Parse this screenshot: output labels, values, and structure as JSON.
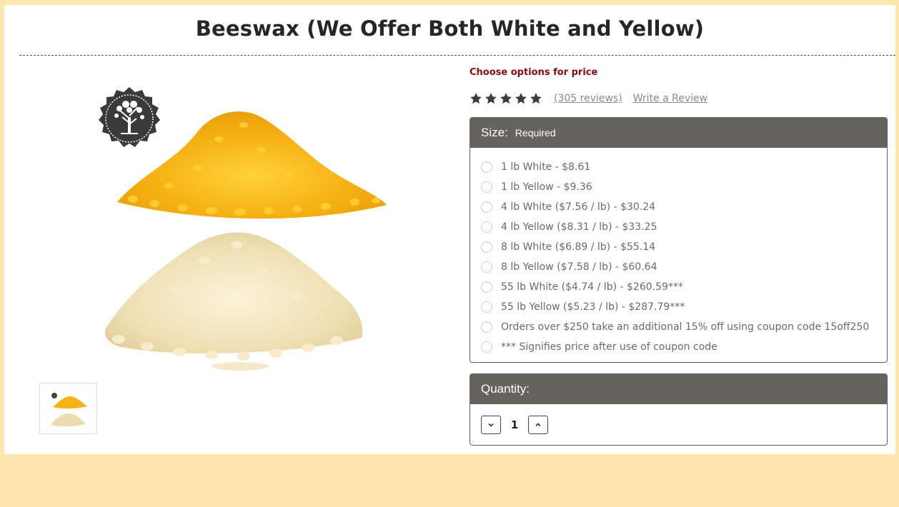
{
  "product": {
    "title": "Beeswax (We Offer Both White and Yellow)",
    "hero_image": "beeswax-pellets-yellow-and-white",
    "thumbnail_image": "beeswax-pellets-thumbnail",
    "seal_icon": "tree-seal-icon"
  },
  "pricing": {
    "choose_options": "Choose options for price"
  },
  "rating": {
    "stars": 5,
    "reviews_label": "(305 reviews)",
    "write_review_label": "Write a Review"
  },
  "size": {
    "label": "Size:",
    "required": "Required",
    "options": [
      "1 lb White - $8.61",
      "1 lb Yellow - $9.36",
      "4 lb White ($7.56 / lb) - $30.24",
      "4 lb Yellow ($8.31 / lb) - $33.25",
      "8 lb White ($6.89 / lb) - $55.14",
      "8 lb Yellow ($7.58 / lb) - $60.64",
      "55 lb White ($4.74 / lb) - $260.59***",
      "55 lb Yellow ($5.23 / lb) - $287.79***",
      "Orders over $250 take an additional 15% off using coupon code 15off250",
      "*** Signifies price after use of coupon code"
    ]
  },
  "quantity": {
    "label": "Quantity:",
    "value": "1",
    "decrement_icon": "chevron-down-icon",
    "increment_icon": "chevron-up-icon"
  },
  "colors": {
    "background": "#fde7ae",
    "panel_header": "#64635e",
    "price_prompt": "#8b0a0a",
    "yellow_wax": "#f4b416",
    "white_wax": "#f3e6c0"
  }
}
